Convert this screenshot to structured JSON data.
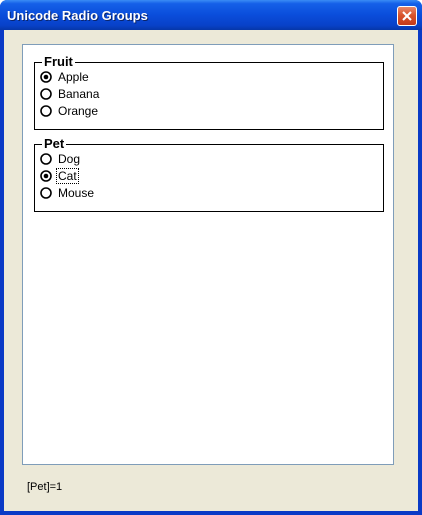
{
  "window": {
    "title": "Unicode Radio Groups",
    "close_icon": "close-icon",
    "colors": {
      "titlebar": "#0a4ddb",
      "client": "#ece9d8",
      "panel_border": "#7f9db9",
      "close_button": "#d9542c"
    }
  },
  "groups": {
    "fruit": {
      "legend": "Fruit",
      "options": [
        {
          "label": "Apple",
          "checked": true
        },
        {
          "label": "Banana",
          "checked": false
        },
        {
          "label": "Orange",
          "checked": false
        }
      ]
    },
    "pet": {
      "legend": "Pet",
      "options": [
        {
          "label": "Dog",
          "checked": false
        },
        {
          "label": "Cat",
          "checked": true,
          "focused": true
        },
        {
          "label": "Mouse",
          "checked": false
        }
      ]
    }
  },
  "status": {
    "text": "[Pet]=1"
  }
}
